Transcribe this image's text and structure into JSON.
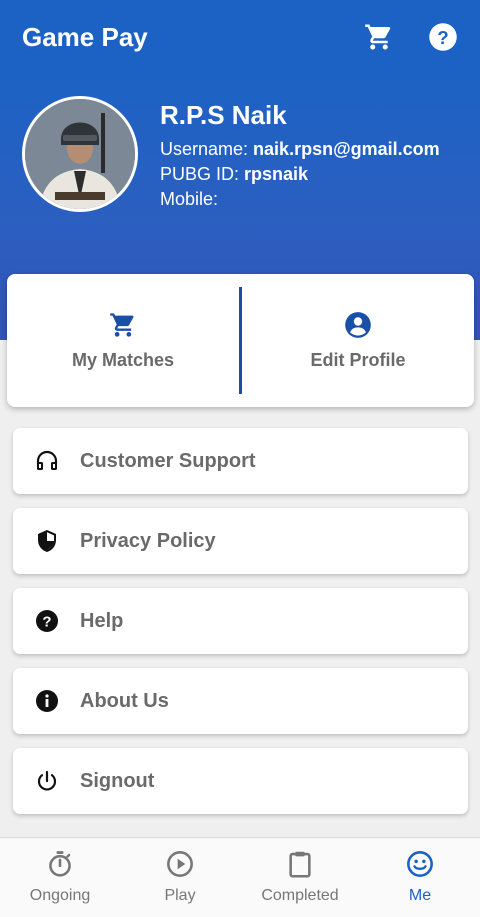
{
  "app_bar": {
    "title": "Game Pay",
    "icons": [
      "cart-icon",
      "help-icon"
    ]
  },
  "profile": {
    "name": "R.P.S Naik",
    "username_label": "Username: ",
    "username": "naik.rpsn@gmail.com",
    "pubg_label": "PUBG ID: ",
    "pubg_id": "rpsnaik",
    "mobile_label": "Mobile:",
    "mobile": ""
  },
  "actions": [
    {
      "label": "My Matches",
      "icon": "cart-icon"
    },
    {
      "label": "Edit Profile",
      "icon": "account-circle-icon"
    }
  ],
  "menu": [
    {
      "label": "Customer Support",
      "icon": "headset-icon"
    },
    {
      "label": "Privacy Policy",
      "icon": "shield-icon"
    },
    {
      "label": "Help",
      "icon": "help-circle-icon"
    },
    {
      "label": "About Us",
      "icon": "info-icon"
    },
    {
      "label": "Signout",
      "icon": "power-icon"
    }
  ],
  "bottom_nav": [
    {
      "label": "Ongoing",
      "icon": "timer-icon"
    },
    {
      "label": "Play",
      "icon": "play-circle-icon"
    },
    {
      "label": "Completed",
      "icon": "clipboard-icon"
    },
    {
      "label": "Me",
      "icon": "smiley-icon",
      "active": true
    }
  ],
  "colors": {
    "primary": "#1c62c4",
    "active": "#1c62c4",
    "inactive": "#777777",
    "divider": "#1a4fa8"
  }
}
